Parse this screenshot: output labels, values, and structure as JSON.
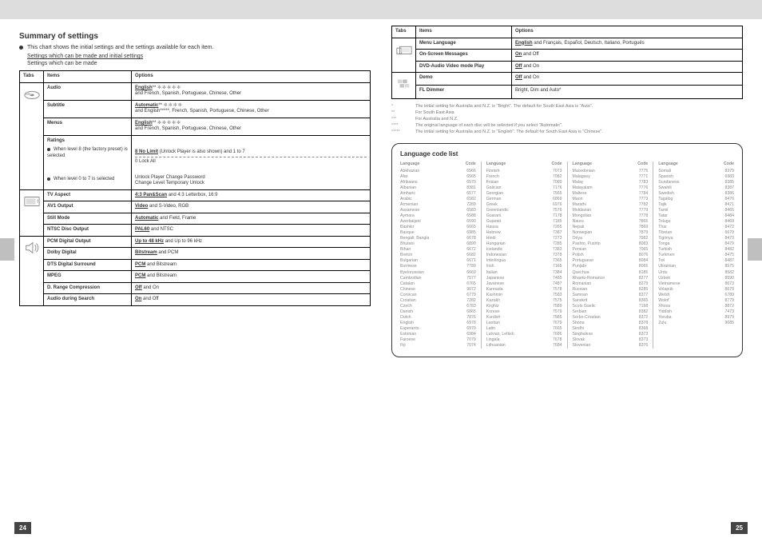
{
  "header": {
    "title": "Summary of settings"
  },
  "intro": {
    "bullet": "This chart shows the initial settings and the settings available for each item.",
    "legend_underlined": "Settings which can be made and initial settings",
    "legend_plain": "Settings which can be made"
  },
  "columns": {
    "tabs": "Tabs",
    "items": "Items",
    "options": "Options"
  },
  "tabs": [
    {
      "icon": "disc",
      "items": [
        {
          "name": "Audio",
          "options": [
            {
              "u": "English",
              "stars": 5,
              "extra": "and French, Spanish, Portuguese, Chinese, Other"
            }
          ]
        },
        {
          "name": "Subtitle",
          "options": [
            {
              "u": "Automatic",
              "stars": 0,
              "extra": "and English*****, French, Spanish, Portuguese, Chinese, Other"
            },
            {
              "stars": 4
            }
          ]
        },
        {
          "name": "Menus",
          "options": [
            {
              "u": "English",
              "stars": 5,
              "extra": "and French, Spanish, Portuguese, Chinese, Other"
            }
          ]
        },
        {
          "name": "Ratings",
          "sub": [
            {
              "label": "When level 8 (the factory preset) is selected",
              "lines": [
                {
                  "u": "8 No Limit",
                  "stars": 0,
                  "note": "(Unlock Player is also shown) and 1 to 7"
                },
                {
                  "plain": "0 Lock All",
                  "dashed": true
                }
              ]
            },
            {
              "label": "When level 0 to 7 is selected",
              "lines": [
                {
                  "plain": "Unlock Player Change Password"
                },
                {
                  "plain": "Change Level Temporary Unlock"
                }
              ]
            }
          ]
        }
      ]
    },
    {
      "icon": "video",
      "items": [
        {
          "name": "TV Aspect",
          "options": [
            {
              "u": "4:3 Pan&Scan",
              "extra": "and 4:3 Letterbox, 16:9"
            }
          ]
        },
        {
          "name": "AV1 Output",
          "options": [
            {
              "u": "Video",
              "extra": "and S-Video, RGB"
            }
          ]
        },
        {
          "name": "Still Mode",
          "options": [
            {
              "u": "Automatic",
              "extra": "and Field, Frame"
            }
          ]
        },
        {
          "name": "NTSC Disc Output",
          "options": [
            {
              "u": "PAL60",
              "extra": "and NTSC"
            }
          ]
        }
      ]
    },
    {
      "icon": "audio",
      "items": [
        {
          "name": "PCM Digital Output",
          "options": [
            {
              "u": "Up to 48 kHz",
              "extra": "and Up to 96 kHz"
            }
          ]
        },
        {
          "name": "Dolby Digital",
          "options": [
            {
              "u": "Bitstream",
              "extra": "and PCM"
            }
          ]
        },
        {
          "name": "DTS Digital Surround",
          "options": [
            {
              "u": "PCM",
              "extra": "and Bitstream"
            }
          ]
        },
        {
          "name": "MPEG",
          "options": [
            {
              "u": "PCM",
              "extra": "and Bitstream"
            }
          ]
        },
        {
          "name": "D. Range Compression",
          "options": [
            {
              "u": "Off",
              "extra": "and On"
            }
          ]
        },
        {
          "name": "Audio during Search",
          "options": [
            {
              "u": "On",
              "extra": "and Off"
            }
          ]
        }
      ]
    }
  ],
  "right_tabs": [
    {
      "icon": "display",
      "items": [
        {
          "name": "Menu Language",
          "options": [
            {
              "u": "English",
              "extra": "and Français, Español, Deutsch, Italiano, Português"
            }
          ]
        },
        {
          "name": "On-Screen Messages",
          "options": [
            {
              "u": "On",
              "extra": "and Off"
            }
          ]
        },
        {
          "name": "DVD-Audio Video mode Play",
          "options": [
            {
              "u": "Off",
              "extra": "and On"
            }
          ]
        }
      ]
    },
    {
      "icon": "others",
      "items": [
        {
          "name": "Demo",
          "options": [
            {
              "u": "Off",
              "extra": "and On"
            }
          ]
        },
        {
          "name": "FL Dimmer",
          "options": [
            {
              "plain": "Bright, Dim and Auto*"
            }
          ]
        }
      ]
    }
  ],
  "footnotes": [
    {
      "m": "*",
      "t": "The initial setting for Australia and N.Z. is \"Bright\". The default for South East Asia is \"Auto\"."
    },
    {
      "m": "**",
      "t": "For South East Asia"
    },
    {
      "m": "***",
      "t": "For Australia and N.Z."
    },
    {
      "m": "****",
      "t": "The original language of each disc will be selected if you select \"Automatic\"."
    },
    {
      "m": "*****",
      "t": "The initial setting for Australia and N.Z. is \"English\". The default for South East Asia is \"Chinese\"."
    }
  ],
  "codelist": {
    "title": "Language code list",
    "headers": {
      "lang": "Language",
      "code": "Code"
    },
    "cols": [
      [
        [
          "Abkhazian",
          "6566"
        ],
        [
          "Afar",
          "6565"
        ],
        [
          "Afrikaans",
          "6570"
        ],
        [
          "Albanian",
          "8381"
        ],
        [
          "Amharic",
          "6577"
        ],
        [
          "Arabic",
          "6582"
        ],
        [
          "Armenian",
          "7289"
        ],
        [
          "Assamese",
          "6583"
        ],
        [
          "Aymara",
          "6588"
        ],
        [
          "Azerbaijani",
          "6590"
        ],
        [
          "Bashkir",
          "6665"
        ],
        [
          "Basque",
          "6985"
        ],
        [
          "Bengali; Bangla",
          "6678"
        ],
        [
          "Bhutani",
          "6890"
        ],
        [
          "Bihari",
          "6672"
        ],
        [
          "Breton",
          "6682"
        ],
        [
          "Bulgarian",
          "6671"
        ],
        [
          "Burmese",
          "7789"
        ],
        [
          "Byelorussian",
          "6669"
        ],
        [
          "Cambodian",
          "7577"
        ],
        [
          "Catalan",
          "6765"
        ],
        [
          "Chinese",
          "9072"
        ],
        [
          "Corsican",
          "6779"
        ],
        [
          "Croatian",
          "7282"
        ],
        [
          "Czech",
          "6783"
        ],
        [
          "Danish",
          "6865"
        ],
        [
          "Dutch",
          "7876"
        ],
        [
          "English",
          "6978"
        ],
        [
          "Esperanto",
          "6979"
        ],
        [
          "Estonian",
          "6984"
        ],
        [
          "Faroese",
          "7079"
        ],
        [
          "Fiji",
          "7074"
        ]
      ],
      [
        [
          "Finnish",
          "7073"
        ],
        [
          "French",
          "7082"
        ],
        [
          "Frisian",
          "7089"
        ],
        [
          "Galician",
          "7176"
        ],
        [
          "Georgian",
          "7565"
        ],
        [
          "German",
          "6869"
        ],
        [
          "Greek",
          "6976"
        ],
        [
          "Greenlandic",
          "7576"
        ],
        [
          "Guarani",
          "7178"
        ],
        [
          "Gujarati",
          "7185"
        ],
        [
          "Hausa",
          "7265"
        ],
        [
          "Hebrew",
          "7387"
        ],
        [
          "Hindi",
          "7273"
        ],
        [
          "Hungarian",
          "7285"
        ],
        [
          "Icelandic",
          "7383"
        ],
        [
          "Indonesian",
          "7378"
        ],
        [
          "Interlingua",
          "7365"
        ],
        [
          "Irish",
          "7165"
        ],
        [
          "Italian",
          "7384"
        ],
        [
          "Japanese",
          "7465"
        ],
        [
          "Javanese",
          "7487"
        ],
        [
          "Kannada",
          "7578"
        ],
        [
          "Kashmiri",
          "7583"
        ],
        [
          "Kazakh",
          "7575"
        ],
        [
          "Kirghiz",
          "7589"
        ],
        [
          "Korean",
          "7579"
        ],
        [
          "Kurdish",
          "7585"
        ],
        [
          "Laotian",
          "7679"
        ],
        [
          "Latin",
          "7665"
        ],
        [
          "Latvian, Lettish",
          "7686"
        ],
        [
          "Lingala",
          "7678"
        ],
        [
          "Lithuanian",
          "7684"
        ]
      ],
      [
        [
          "Macedonian",
          "7775"
        ],
        [
          "Malagasy",
          "7771"
        ],
        [
          "Malay",
          "7783"
        ],
        [
          "Malayalam",
          "7776"
        ],
        [
          "Maltese",
          "7784"
        ],
        [
          "Maori",
          "7773"
        ],
        [
          "Marathi",
          "7782"
        ],
        [
          "Moldavian",
          "7779"
        ],
        [
          "Mongolian",
          "7778"
        ],
        [
          "Nauru",
          "7865"
        ],
        [
          "Nepali",
          "7869"
        ],
        [
          "Norwegian",
          "7879"
        ],
        [
          "Oriya",
          "7982"
        ],
        [
          "Pashto, Pushto",
          "8083"
        ],
        [
          "Persian",
          "7065"
        ],
        [
          "Polish",
          "8076"
        ],
        [
          "Portuguese",
          "8084"
        ],
        [
          "Punjabi",
          "8065"
        ],
        [
          "Quechua",
          "8185"
        ],
        [
          "Rhaeto-Romance",
          "8277"
        ],
        [
          "Romanian",
          "8279"
        ],
        [
          "Russian",
          "8285"
        ],
        [
          "Samoan",
          "8377"
        ],
        [
          "Sanskrit",
          "8365"
        ],
        [
          "Scots Gaelic",
          "7168"
        ],
        [
          "Serbian",
          "8382"
        ],
        [
          "Serbo-Croatian",
          "8372"
        ],
        [
          "Shona",
          "8378"
        ],
        [
          "Sindhi",
          "8368"
        ],
        [
          "Singhalese",
          "8373"
        ],
        [
          "Slovak",
          "8373"
        ],
        [
          "Slovenian",
          "8376"
        ]
      ],
      [
        [
          "Somali",
          "8379"
        ],
        [
          "Spanish",
          "6983"
        ],
        [
          "Sundanese",
          "8385"
        ],
        [
          "Swahili",
          "8387"
        ],
        [
          "Swedish",
          "8386"
        ],
        [
          "Tagalog",
          "8476"
        ],
        [
          "Tajik",
          "8471"
        ],
        [
          "Tamil",
          "8465"
        ],
        [
          "Tatar",
          "8484"
        ],
        [
          "Telugu",
          "8469"
        ],
        [
          "Thai",
          "8472"
        ],
        [
          "Tibetan",
          "6679"
        ],
        [
          "Tigrinya",
          "8473"
        ],
        [
          "Tonga",
          "8479"
        ],
        [
          "Turkish",
          "8482"
        ],
        [
          "Turkmen",
          "8475"
        ],
        [
          "Twi",
          "8487"
        ],
        [
          "Ukrainian",
          "8575"
        ],
        [
          "Urdu",
          "8582"
        ],
        [
          "Uzbek",
          "8590"
        ],
        [
          "Vietnamese",
          "8673"
        ],
        [
          "Volapük",
          "8679"
        ],
        [
          "Welsh",
          "6789"
        ],
        [
          "Wolof",
          "8779"
        ],
        [
          "Xhosa",
          "8872"
        ],
        [
          "Yiddish",
          "7473"
        ],
        [
          "Yoruba",
          "8979"
        ],
        [
          "Zulu",
          "9085"
        ]
      ]
    ]
  },
  "page_left": "24",
  "page_right": "25"
}
